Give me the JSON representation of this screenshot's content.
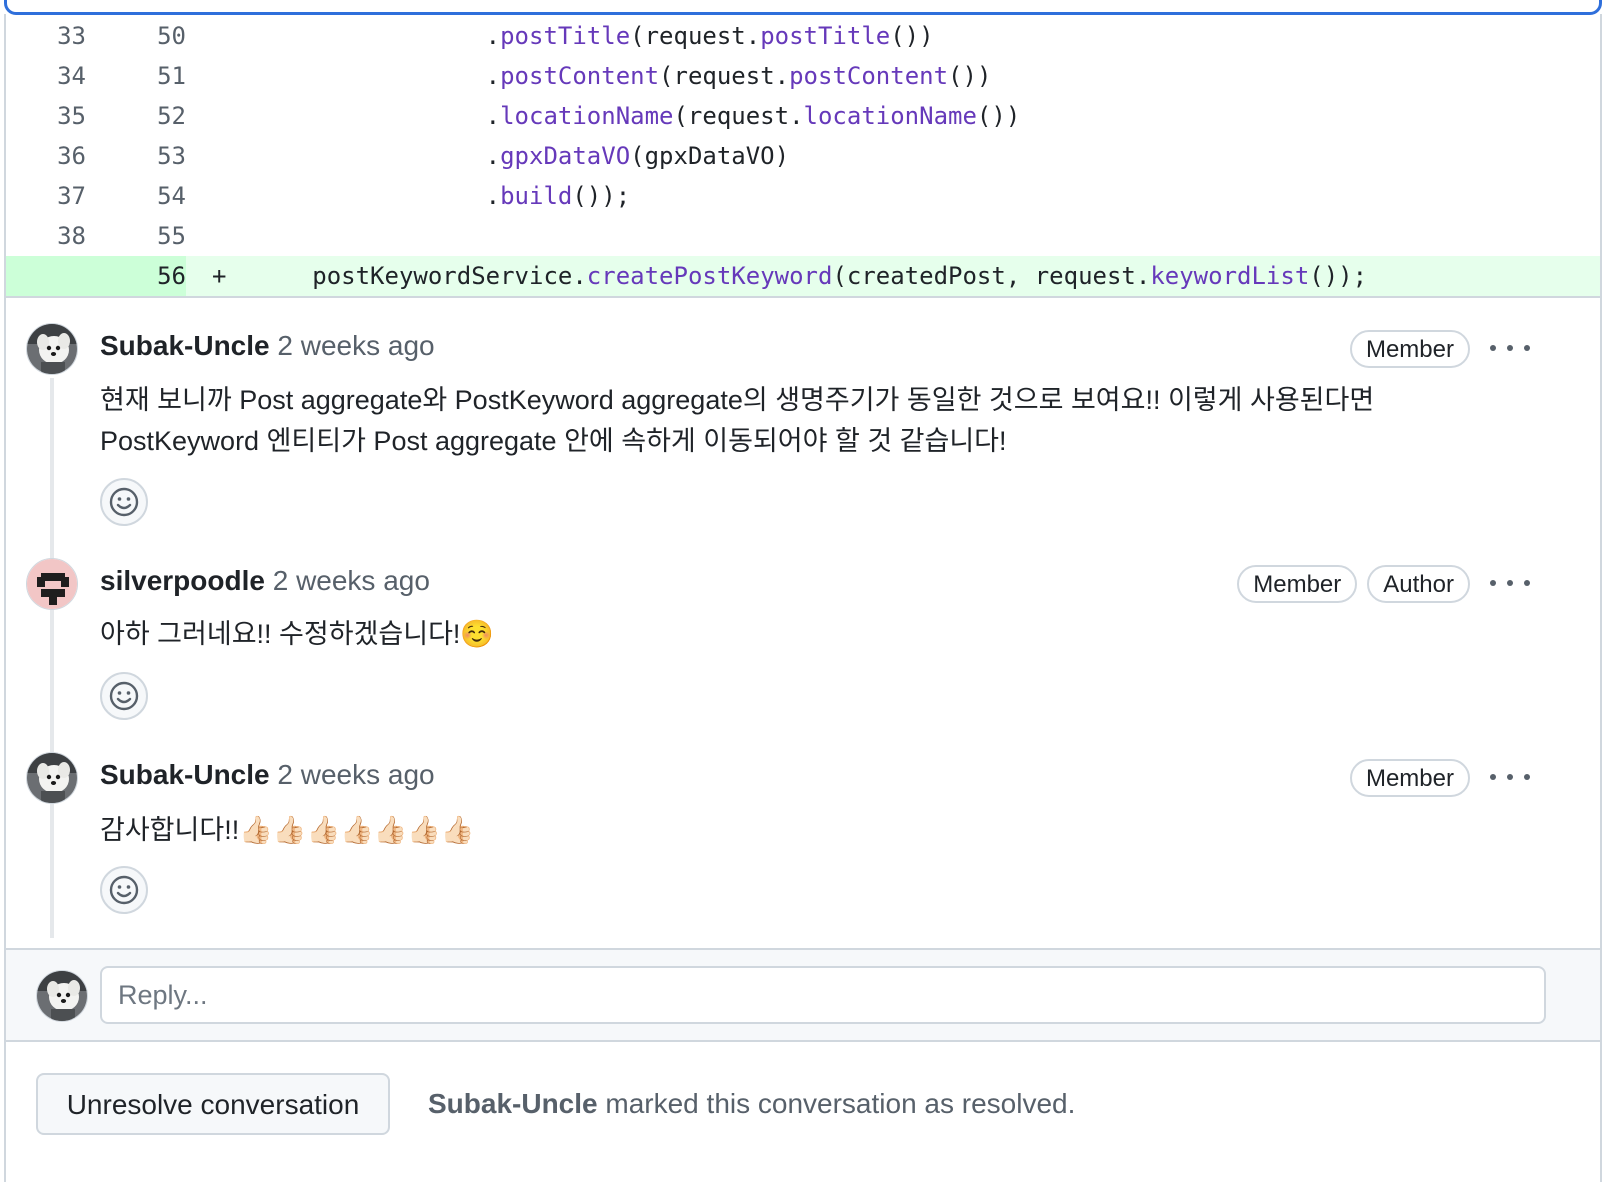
{
  "diff": {
    "rows": [
      {
        "old": "33",
        "new": "50",
        "marker": "",
        "indent": "                 ",
        "tokens": [
          {
            "t": ".",
            "c": "d"
          },
          {
            "t": "postTitle",
            "c": "m"
          },
          {
            "t": "(request.",
            "c": "d"
          },
          {
            "t": "postTitle",
            "c": "m"
          },
          {
            "t": "())",
            "c": "d"
          }
        ]
      },
      {
        "old": "34",
        "new": "51",
        "marker": "",
        "indent": "                 ",
        "tokens": [
          {
            "t": ".",
            "c": "d"
          },
          {
            "t": "postContent",
            "c": "m"
          },
          {
            "t": "(request.",
            "c": "d"
          },
          {
            "t": "postContent",
            "c": "m"
          },
          {
            "t": "())",
            "c": "d"
          }
        ]
      },
      {
        "old": "35",
        "new": "52",
        "marker": "",
        "indent": "                 ",
        "tokens": [
          {
            "t": ".",
            "c": "d"
          },
          {
            "t": "locationName",
            "c": "m"
          },
          {
            "t": "(request.",
            "c": "d"
          },
          {
            "t": "locationName",
            "c": "m"
          },
          {
            "t": "())",
            "c": "d"
          }
        ]
      },
      {
        "old": "36",
        "new": "53",
        "marker": "",
        "indent": "                 ",
        "tokens": [
          {
            "t": ".",
            "c": "d"
          },
          {
            "t": "gpxDataVO",
            "c": "m"
          },
          {
            "t": "(gpxDataVO)",
            "c": "d"
          }
        ]
      },
      {
        "old": "37",
        "new": "54",
        "marker": "",
        "indent": "                 ",
        "tokens": [
          {
            "t": ".",
            "c": "d"
          },
          {
            "t": "build",
            "c": "m"
          },
          {
            "t": "());",
            "c": "d"
          }
        ]
      },
      {
        "old": "38",
        "new": "55",
        "marker": "",
        "indent": "",
        "tokens": []
      },
      {
        "old": "",
        "new": "56",
        "marker": "+",
        "indent": "     ",
        "added": true,
        "tokens": [
          {
            "t": "postKeywordService.",
            "c": "d"
          },
          {
            "t": "createPostKeyword",
            "c": "m"
          },
          {
            "t": "(createdPost, request.",
            "c": "d"
          },
          {
            "t": "keywordList",
            "c": "m"
          },
          {
            "t": "());",
            "c": "d"
          }
        ]
      }
    ]
  },
  "comments": [
    {
      "author": "Subak-Uncle",
      "time": "2 weeks ago",
      "badges": [
        "Member"
      ],
      "body": "현재 보니까 Post aggregate와 PostKeyword aggregate의 생명주기가 동일한 것으로 보여요!! 이렇게 사용된다면\nPostKeyword 엔티티가 Post aggregate 안에 속하게 이동되어야 할 것 같습니다!",
      "avatar": "dog-avatar"
    },
    {
      "author": "silverpoodle",
      "time": "2 weeks ago",
      "badges": [
        "Member",
        "Author"
      ],
      "body": "아하 그러네요!! 수정하겠습니다!☺️",
      "avatar": "pixel-avatar"
    },
    {
      "author": "Subak-Uncle",
      "time": "2 weeks ago",
      "badges": [
        "Member"
      ],
      "body": "감사합니다!!👍🏻👍🏻👍🏻👍🏻👍🏻👍🏻👍🏻",
      "avatar": "dog-avatar"
    }
  ],
  "reply": {
    "placeholder": "Reply..."
  },
  "footer": {
    "unresolve_label": "Unresolve conversation",
    "resolved_by": "Subak-Uncle",
    "resolved_text": " marked this conversation as resolved."
  },
  "icons": {
    "react": "smiley-icon",
    "more": "kebab-horizontal-icon"
  },
  "colors": {
    "method": "#6639ba",
    "added_bg": "#e6ffec",
    "added_ln_bg": "#ccffd8",
    "focus_border": "#2f6fdb",
    "muted": "#57606a"
  }
}
